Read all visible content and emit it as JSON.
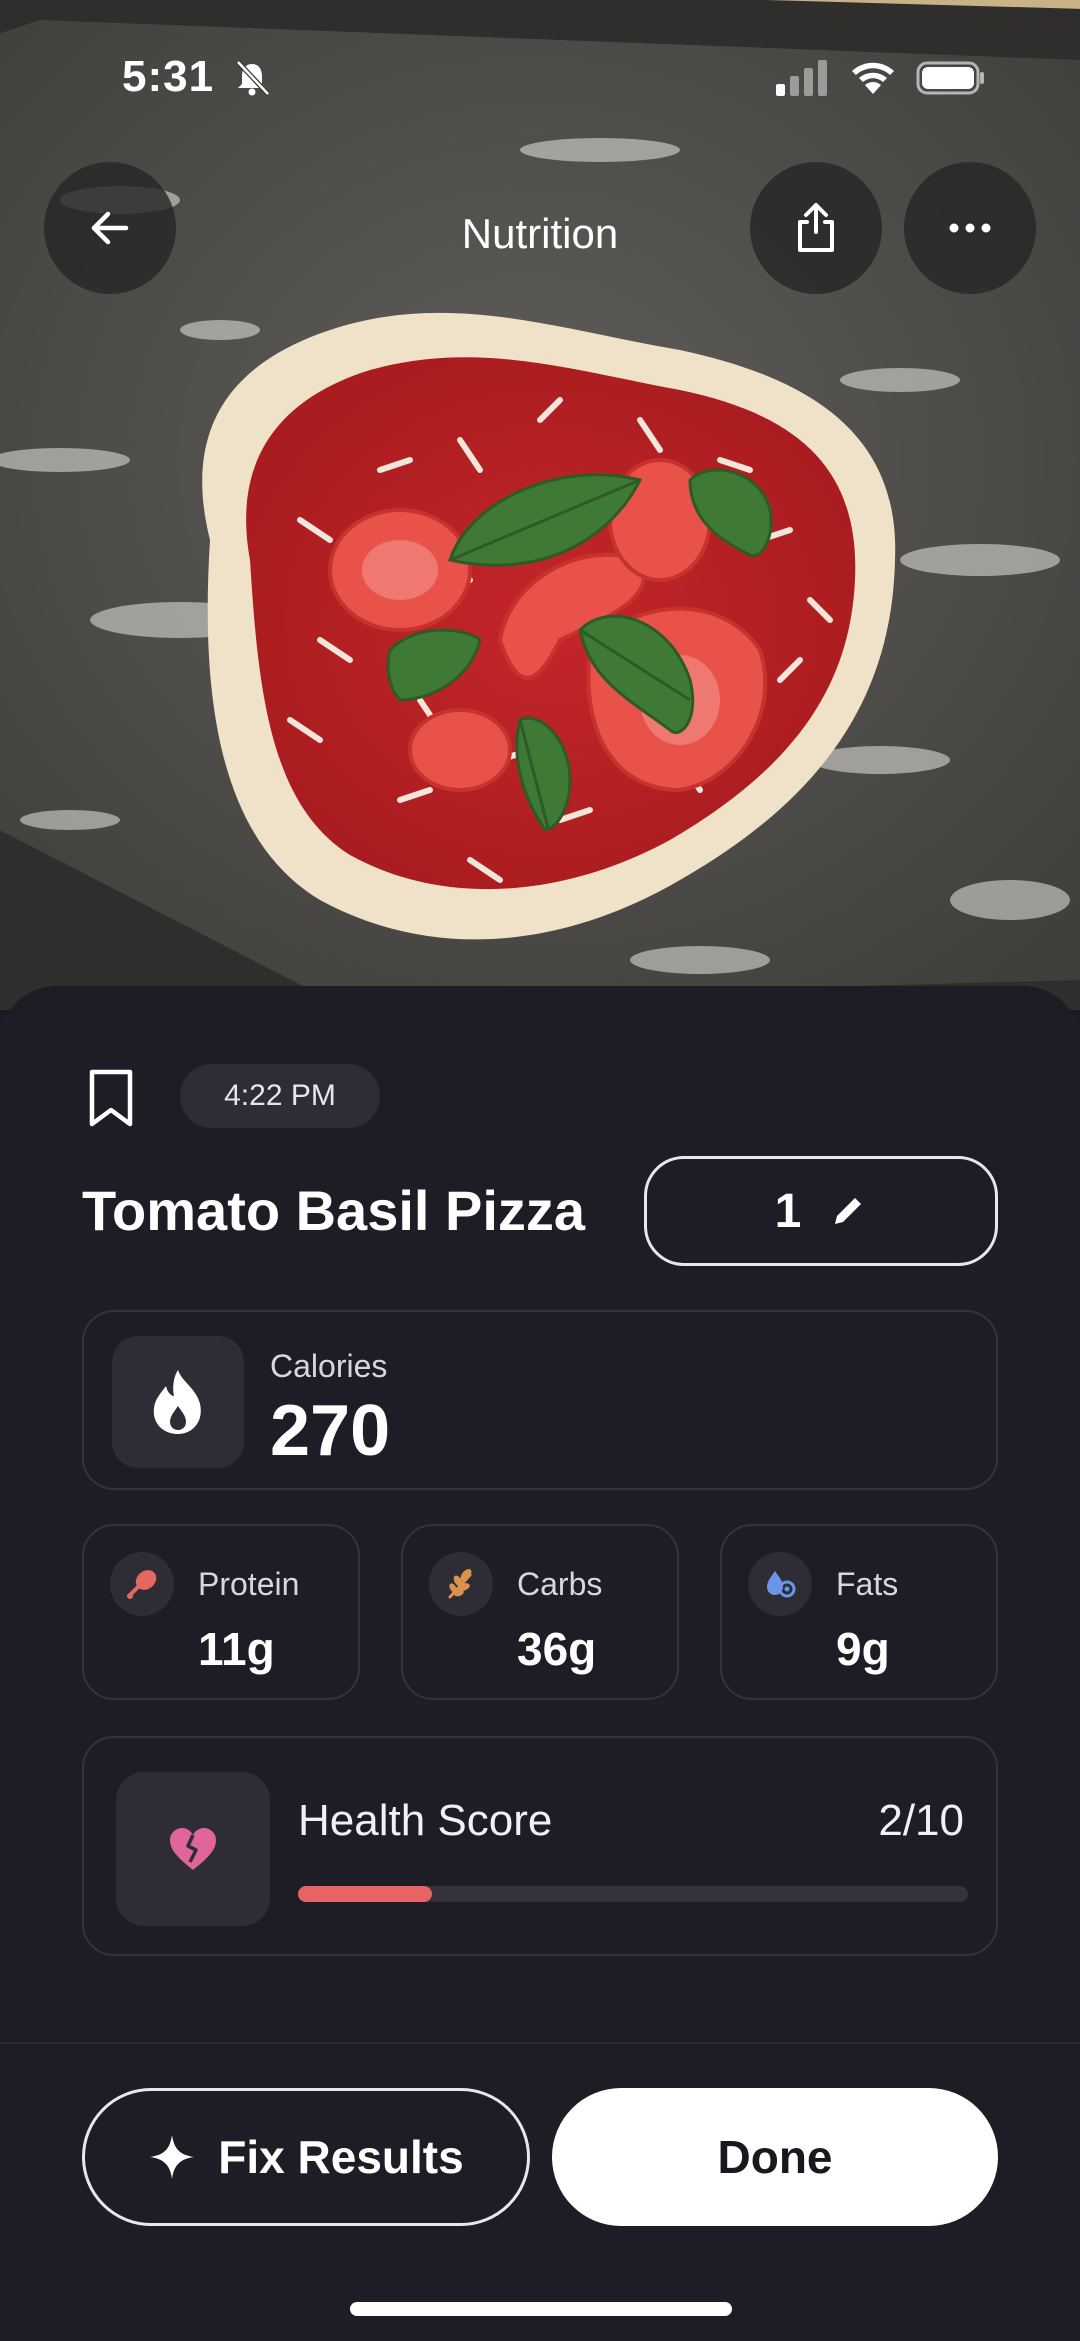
{
  "status_bar": {
    "time": "5:31"
  },
  "header": {
    "title": "Nutrition"
  },
  "meal": {
    "time": "4:22 PM",
    "name": "Tomato Basil Pizza",
    "quantity": "1"
  },
  "calories": {
    "label": "Calories",
    "value": "270"
  },
  "macros": [
    {
      "label": "Protein",
      "value": "11g",
      "icon": "drumstick-icon",
      "color": "#e5675f"
    },
    {
      "label": "Carbs",
      "value": "36g",
      "icon": "wheat-icon",
      "color": "#d9934f"
    },
    {
      "label": "Fats",
      "value": "9g",
      "icon": "oil-drop-icon",
      "color": "#6b95e8"
    }
  ],
  "health": {
    "label": "Health Score",
    "score": "2/10",
    "fraction": 0.2,
    "color": "#e86464",
    "icon": "broken-heart-icon"
  },
  "actions": {
    "fix_label": "Fix Results",
    "done_label": "Done"
  }
}
